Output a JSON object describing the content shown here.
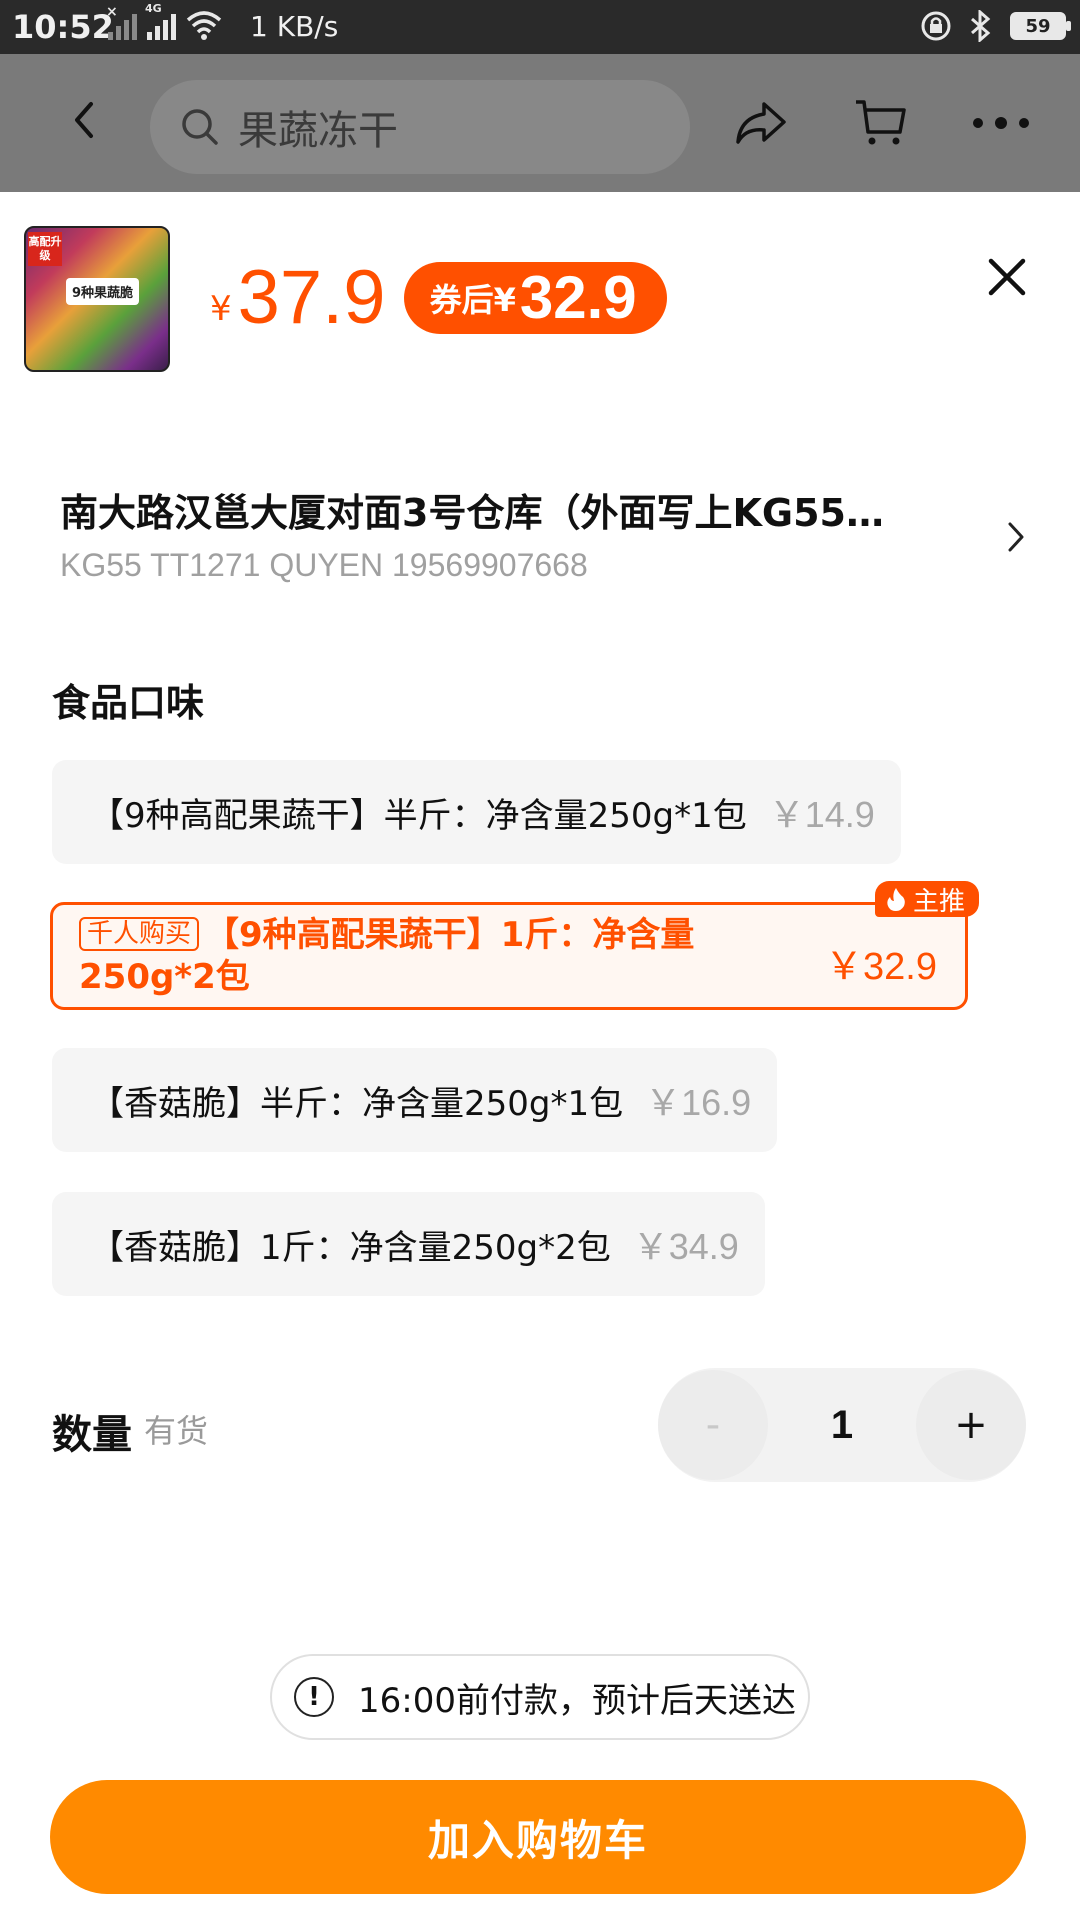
{
  "status_bar": {
    "time": "10:52",
    "net_speed": "1 KB/s",
    "battery": "59"
  },
  "header": {
    "search_placeholder": "果蔬冻干"
  },
  "product": {
    "thumb_tag": "高配升级",
    "thumb_label": "9种果蔬脆",
    "currency_symbol": "¥",
    "price": "37.9",
    "coupon_label": "券后¥",
    "coupon_price": "32.9"
  },
  "address": {
    "line1": "南大路汉邕大厦对面3号仓库（外面写上KG55…",
    "line2": "KG55 TT1271 QUYEN 19569907668"
  },
  "flavor": {
    "title": "食品口味",
    "options": [
      {
        "label": "【9种高配果蔬干】半斤：净含量250g*1包",
        "price": "￥14.9"
      },
      {
        "badge": "千人购买",
        "label": "【9种高配果蔬干】1斤：净含量250g*2包",
        "price": "￥32.9",
        "hot_tag": "主推",
        "selected": true
      },
      {
        "label": "【香菇脆】半斤：净含量250g*1包",
        "price": "￥16.9"
      },
      {
        "label": "【香菇脆】1斤：净含量250g*2包",
        "price": "￥34.9"
      }
    ]
  },
  "quantity": {
    "label": "数量",
    "availability": "有货",
    "minus": "-",
    "value": "1",
    "plus": "+"
  },
  "delivery": {
    "info_glyph": "!",
    "text": "16:00前付款，预计后天送达"
  },
  "cta": {
    "add_to_cart": "加入购物车"
  },
  "colors": {
    "accent": "#ff5000",
    "cta": "#ff8a00"
  }
}
